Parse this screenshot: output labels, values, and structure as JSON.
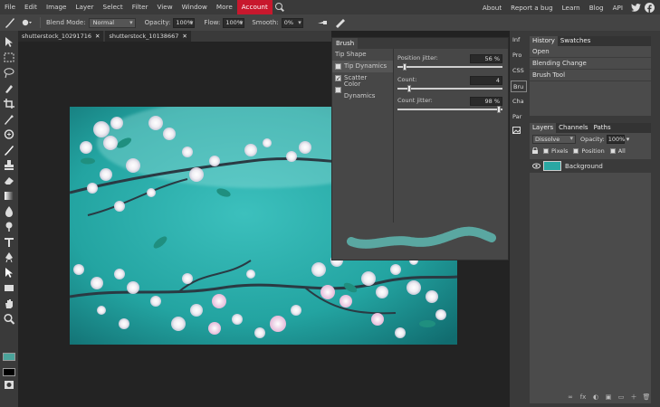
{
  "menu": {
    "items": [
      "File",
      "Edit",
      "Image",
      "Layer",
      "Select",
      "Filter",
      "View",
      "Window",
      "More",
      "Account"
    ],
    "active": "Account",
    "right_links": [
      "About",
      "Report a bug",
      "Learn",
      "Blog",
      "API"
    ]
  },
  "options": {
    "blend_mode_label": "Blend Mode:",
    "blend_mode_value": "Normal",
    "opacity_label": "Opacity:",
    "opacity_value": "100%",
    "flow_label": "Flow:",
    "flow_value": "100%",
    "smooth_label": "Smooth:",
    "smooth_value": "0%"
  },
  "doc_tabs": [
    {
      "label": "shutterstock_10291716"
    },
    {
      "label": "shutterstock_10138667"
    }
  ],
  "brush_panel": {
    "title": "Brush",
    "options": [
      {
        "label": "Tip Shape",
        "checkbox": false,
        "selected": false
      },
      {
        "label": "Tip Dynamics",
        "checkbox": true,
        "checked": false,
        "selected": true
      },
      {
        "label": "Scatter",
        "checkbox": true,
        "checked": true,
        "selected": false
      },
      {
        "label": "Color Dynamics",
        "checkbox": true,
        "checked": false,
        "selected": false
      }
    ],
    "fields": [
      {
        "label": "Position jitter:",
        "value": "56 %",
        "level": 0.05
      },
      {
        "label": "Count:",
        "value": "4",
        "level": 0.1
      },
      {
        "label": "Count jitter:",
        "value": "98 %",
        "level": 0.98
      }
    ],
    "stroke_color": "#5aa7a1"
  },
  "side_icons": [
    "Inf",
    "Pro",
    "CSS",
    "Bru",
    "Cha",
    "Par"
  ],
  "history": {
    "tabs": [
      "History",
      "Swatches"
    ],
    "rows": [
      "Open",
      "Blending Change",
      "Brush Tool"
    ]
  },
  "layers": {
    "tabs": [
      "Layers",
      "Channels",
      "Paths"
    ],
    "blend": "Dissolve",
    "opacity_label": "Opacity:",
    "opacity_value": "100%",
    "lock_options": [
      "Pixels",
      "Position",
      "All"
    ],
    "layer_name": "Background"
  },
  "colors": {
    "foreground": "#4aa39a",
    "background": "#000000",
    "accent": "#c8182d"
  }
}
